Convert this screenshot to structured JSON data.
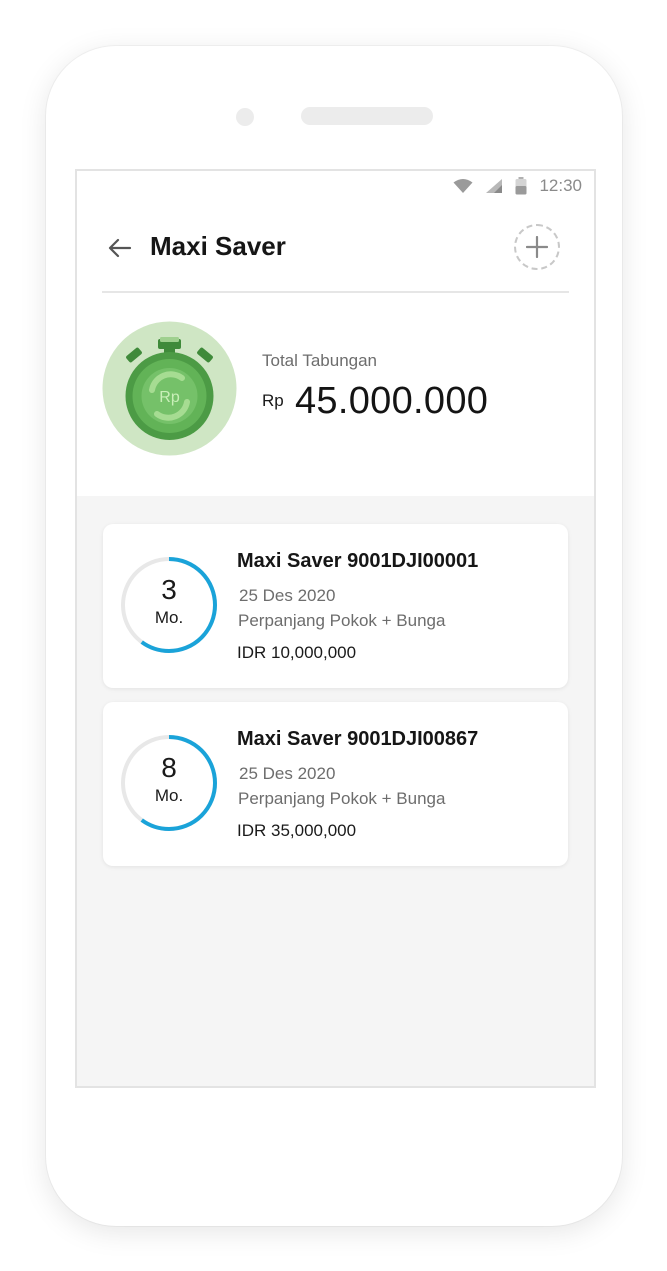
{
  "status_bar": {
    "time": "12:30"
  },
  "header": {
    "title": "Maxi Saver",
    "back_icon": "arrow-left-icon",
    "add_icon": "plus-icon"
  },
  "summary": {
    "icon": "stopwatch-rupiah-icon",
    "icon_text": "Rp",
    "label": "Total Tabungan",
    "currency": "Rp",
    "amount": "45.000.000"
  },
  "deposits": [
    {
      "title": "Maxi Saver 9001DJI00001",
      "date": "25 Des 2020",
      "mode": "Perpanjang Pokok + Bunga",
      "amount": "IDR 10,000,000",
      "months": "3",
      "months_unit": "Mo.",
      "progress": 0.6
    },
    {
      "title": "Maxi Saver 9001DJI00867",
      "date": "25 Des 2020",
      "mode": "Perpanjang Pokok + Bunga",
      "amount": "IDR 35,000,000",
      "months": "8",
      "months_unit": "Mo.",
      "progress": 0.6
    }
  ],
  "colors": {
    "accent_blue": "#1aa3d9",
    "ring_track": "#e8e8e8",
    "icon_bg_green": "#cfe6c4",
    "icon_green": "#5aae51"
  }
}
